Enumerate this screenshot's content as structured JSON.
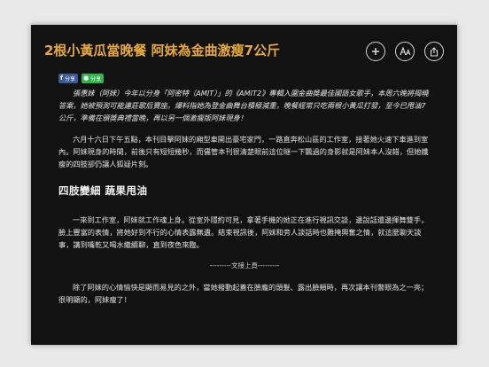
{
  "article": {
    "title": "2根小黃瓜當晚餐 阿妹為金曲激瘦7公斤",
    "share_buttons": {
      "facebook": "分享",
      "line": "分享"
    },
    "paragraphs": [
      "張惠妹（阿妹）今年以分身「阿密特（AMIT）」的《AMIT2》專輯入圍金曲獎最佳國語女歌手，本周六晚將揭曉答案，她被預測可能連莊歌后寶座。爆料指她為登金曲舞台積極減重，晚餐經常只吃兩根小黃瓜打發，至今已甩油7公斤，準備在頒獎典禮當晚，再以另一個激瘦版阿妹現身！",
      "六月十六日下午五點，本刊目擊阿妹的廂型車開出豪宅家門，一路直奔松山區的工作室，接著她火速下車進到室內。阿妹現身的時間，前後只有短短幾秒，而儘管本刊很清楚眼前這位瞇一下飄過的身影就是阿妹本人沒錯，但她纖瘦的四肢卻仍讓人狐疑片刻。"
    ],
    "subheading": "四肢變細 蔬果甩油",
    "paragraphs_after": [
      "一來到工作室，阿妹就工作魂上身。從室外隱約可見，拿著手機的她正在進行視訊交談，邊說話還邊揮舞雙手，臉上豐富的表情，將她好到不行的心情表露無遺。結束視訊後，阿妹和旁人談話時也難掩興奮之情，就這麼聊天談事，講到嘴乾又喝水繼續聊，直到夜色來臨。"
    ],
    "divider": "---------文接上頁---------",
    "paragraphs_final": [
      "除了阿妹的心情愉快是顯而易見的之外，當她撥動起蓋在臉龐的頭髮、露出臉頰時，再次讓本刊瞥眼為之一亮；很明顯的，阿妹瘦了！"
    ]
  },
  "actions": {
    "add_icon": "plus-icon",
    "font_icon": "font-size-icon",
    "share_icon": "share-icon"
  },
  "colors": {
    "title": "#e8a93a",
    "panel_bg": "#121212",
    "facebook": "#3b5998",
    "line": "#2fb547"
  }
}
